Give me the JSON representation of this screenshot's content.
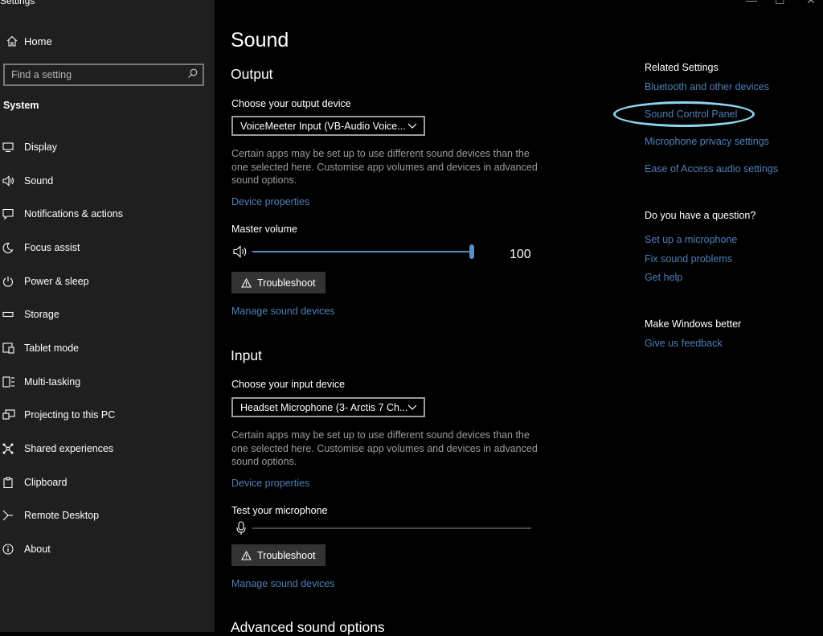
{
  "window": {
    "title": "Settings",
    "controls": {
      "minimize": "—",
      "maximize": "☐",
      "close": "✕"
    }
  },
  "sidebar": {
    "home_label": "Home",
    "search_placeholder": "Find a setting",
    "section_label": "System",
    "items": [
      {
        "label": "Display",
        "icon": "display-icon"
      },
      {
        "label": "Sound",
        "icon": "speaker-icon"
      },
      {
        "label": "Notifications & actions",
        "icon": "notification-icon"
      },
      {
        "label": "Focus assist",
        "icon": "moon-icon"
      },
      {
        "label": "Power & sleep",
        "icon": "power-icon"
      },
      {
        "label": "Storage",
        "icon": "storage-icon"
      },
      {
        "label": "Tablet mode",
        "icon": "tablet-icon"
      },
      {
        "label": "Multi-tasking",
        "icon": "multitasking-icon"
      },
      {
        "label": "Projecting to this PC",
        "icon": "projecting-icon"
      },
      {
        "label": "Shared experiences",
        "icon": "shared-icon"
      },
      {
        "label": "Clipboard",
        "icon": "clipboard-icon"
      },
      {
        "label": "Remote Desktop",
        "icon": "remote-desktop-icon"
      },
      {
        "label": "About",
        "icon": "info-icon"
      }
    ]
  },
  "main": {
    "title": "Sound",
    "output": {
      "heading": "Output",
      "device_label": "Choose your output device",
      "device_value": "VoiceMeeter Input (VB-Audio Voice...",
      "note": "Certain apps may be set up to use different sound devices than the one selected here. Customise app volumes and devices in advanced sound options.",
      "device_properties": "Device properties",
      "volume_label": "Master volume",
      "volume_value": "100",
      "volume_level": 1.0,
      "troubleshoot": "Troubleshoot",
      "manage": "Manage sound devices"
    },
    "input": {
      "heading": "Input",
      "device_label": "Choose your input device",
      "device_value": "Headset Microphone (3- Arctis 7 Ch...",
      "note": "Certain apps may be set up to use different sound devices than the one selected here. Customise app volumes and devices in advanced sound options.",
      "device_properties": "Device properties",
      "test_label": "Test your microphone",
      "mic_level": 0.0,
      "troubleshoot": "Troubleshoot",
      "manage": "Manage sound devices"
    },
    "advanced_heading": "Advanced sound options"
  },
  "related": {
    "heading": "Related Settings",
    "links": [
      "Bluetooth and other devices",
      "Sound Control Panel",
      "Microphone privacy settings",
      "Ease of Access audio settings"
    ],
    "question_heading": "Do you have a question?",
    "question_links": [
      "Set up a microphone",
      "Fix sound problems",
      "Get help"
    ],
    "better_heading": "Make Windows better",
    "feedback_link": "Give us feedback"
  },
  "colors": {
    "accent": "#4f7fb8",
    "slider_fill": "#5b8dc4",
    "annotation": "#8fd4ee",
    "sidebar_bg": "#1f1f1f"
  }
}
